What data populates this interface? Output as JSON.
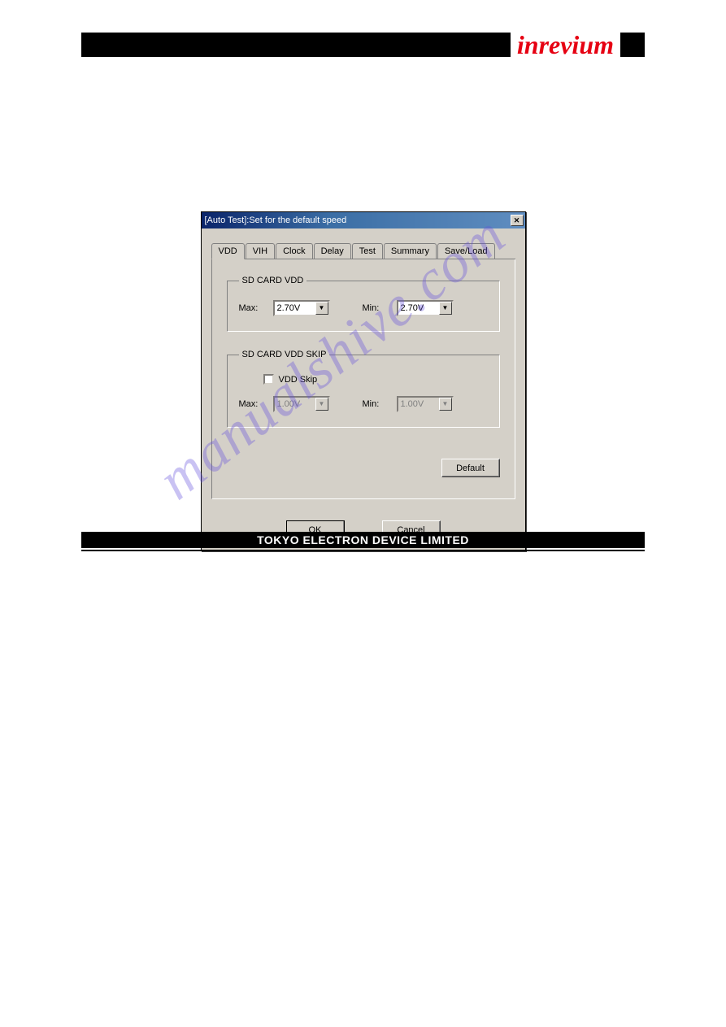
{
  "brand": "inrevium",
  "footer": "TOKYO ELECTRON DEVICE LIMITED",
  "watermark": "manualshive.com",
  "dialog": {
    "title": "[Auto Test]:Set for the default speed",
    "tabs": [
      "VDD",
      "VIH",
      "Clock",
      "Delay",
      "Test",
      "Summary",
      "Save/Load"
    ],
    "active_tab": 0,
    "groups": {
      "vdd": {
        "legend": "SD CARD VDD",
        "max_label": "Max:",
        "max_value": "2.70V",
        "min_label": "Min:",
        "min_value": "2.70V"
      },
      "vdd_skip": {
        "legend": "SD CARD VDD  SKIP",
        "checkbox_label": "VDD Skip",
        "checked": false,
        "max_label": "Max:",
        "max_value": "1.00V",
        "min_label": "Min:",
        "min_value": "1.00V"
      }
    },
    "default_btn": "Default",
    "ok_btn": "OK",
    "cancel_btn": "Cancel"
  }
}
